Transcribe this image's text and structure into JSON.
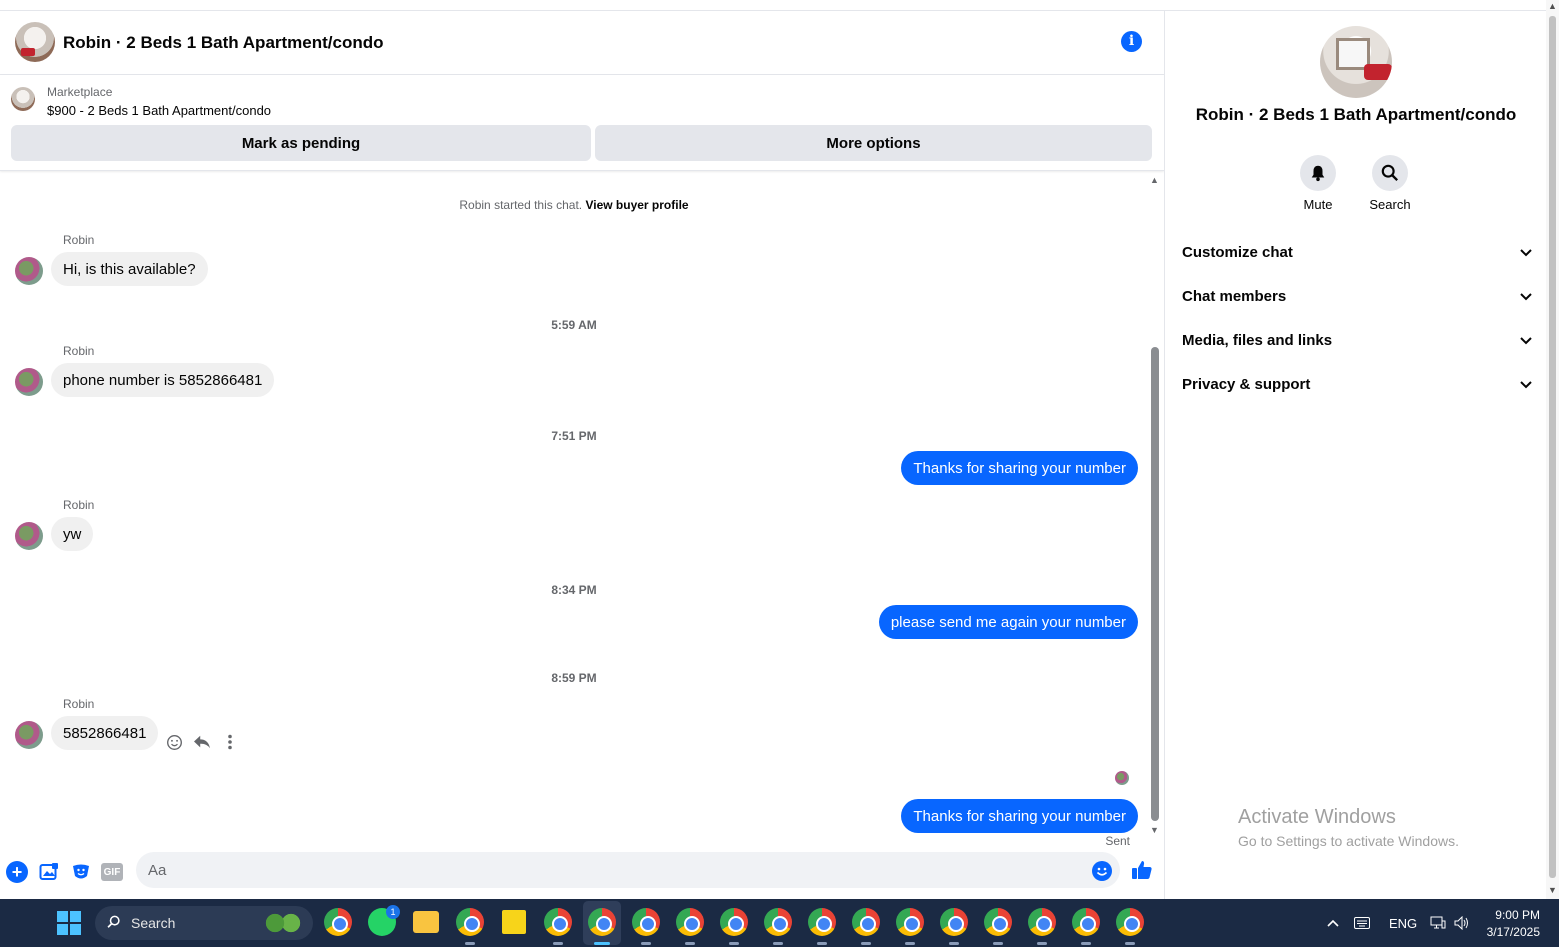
{
  "header": {
    "title": "Robin · 2 Beds 1 Bath Apartment/condo"
  },
  "marketplace": {
    "label": "Marketplace",
    "listing": "$900 - 2 Beds 1 Bath Apartment/condo",
    "pending_button": "Mark as pending",
    "more_button": "More options"
  },
  "messages": {
    "system_prefix": "Robin started this chat.",
    "system_link": "View buyer profile",
    "sender": "Robin",
    "m1": "Hi, is this available?",
    "t1": "5:59 AM",
    "m2": "phone number is 5852866481",
    "t2": "7:51 PM",
    "m3": "Thanks for sharing your number",
    "m4": "yw",
    "t3": "8:34 PM",
    "m5": "please send me again your number",
    "t4": "8:59 PM",
    "m6": "5852866481",
    "m7": "Thanks for sharing your number",
    "status": "Sent"
  },
  "composer": {
    "placeholder": "Aa",
    "gif_label": "GIF"
  },
  "sidebar": {
    "title": "Robin · 2 Beds 1 Bath Apartment/condo",
    "mute_label": "Mute",
    "search_label": "Search",
    "sections": [
      "Customize chat",
      "Chat members",
      "Media, files and links",
      "Privacy & support"
    ]
  },
  "watermark": {
    "line1": "Activate Windows",
    "line2": "Go to Settings to activate Windows."
  },
  "taskbar": {
    "search_label": "Search",
    "lang": "ENG",
    "time": "9:00 PM",
    "date": "3/17/2025",
    "whatsapp_badge": "1"
  },
  "colors": {
    "accent": "#0866ff",
    "bubble_in": "#f0f0f0",
    "taskbar": "#1b2a44"
  }
}
